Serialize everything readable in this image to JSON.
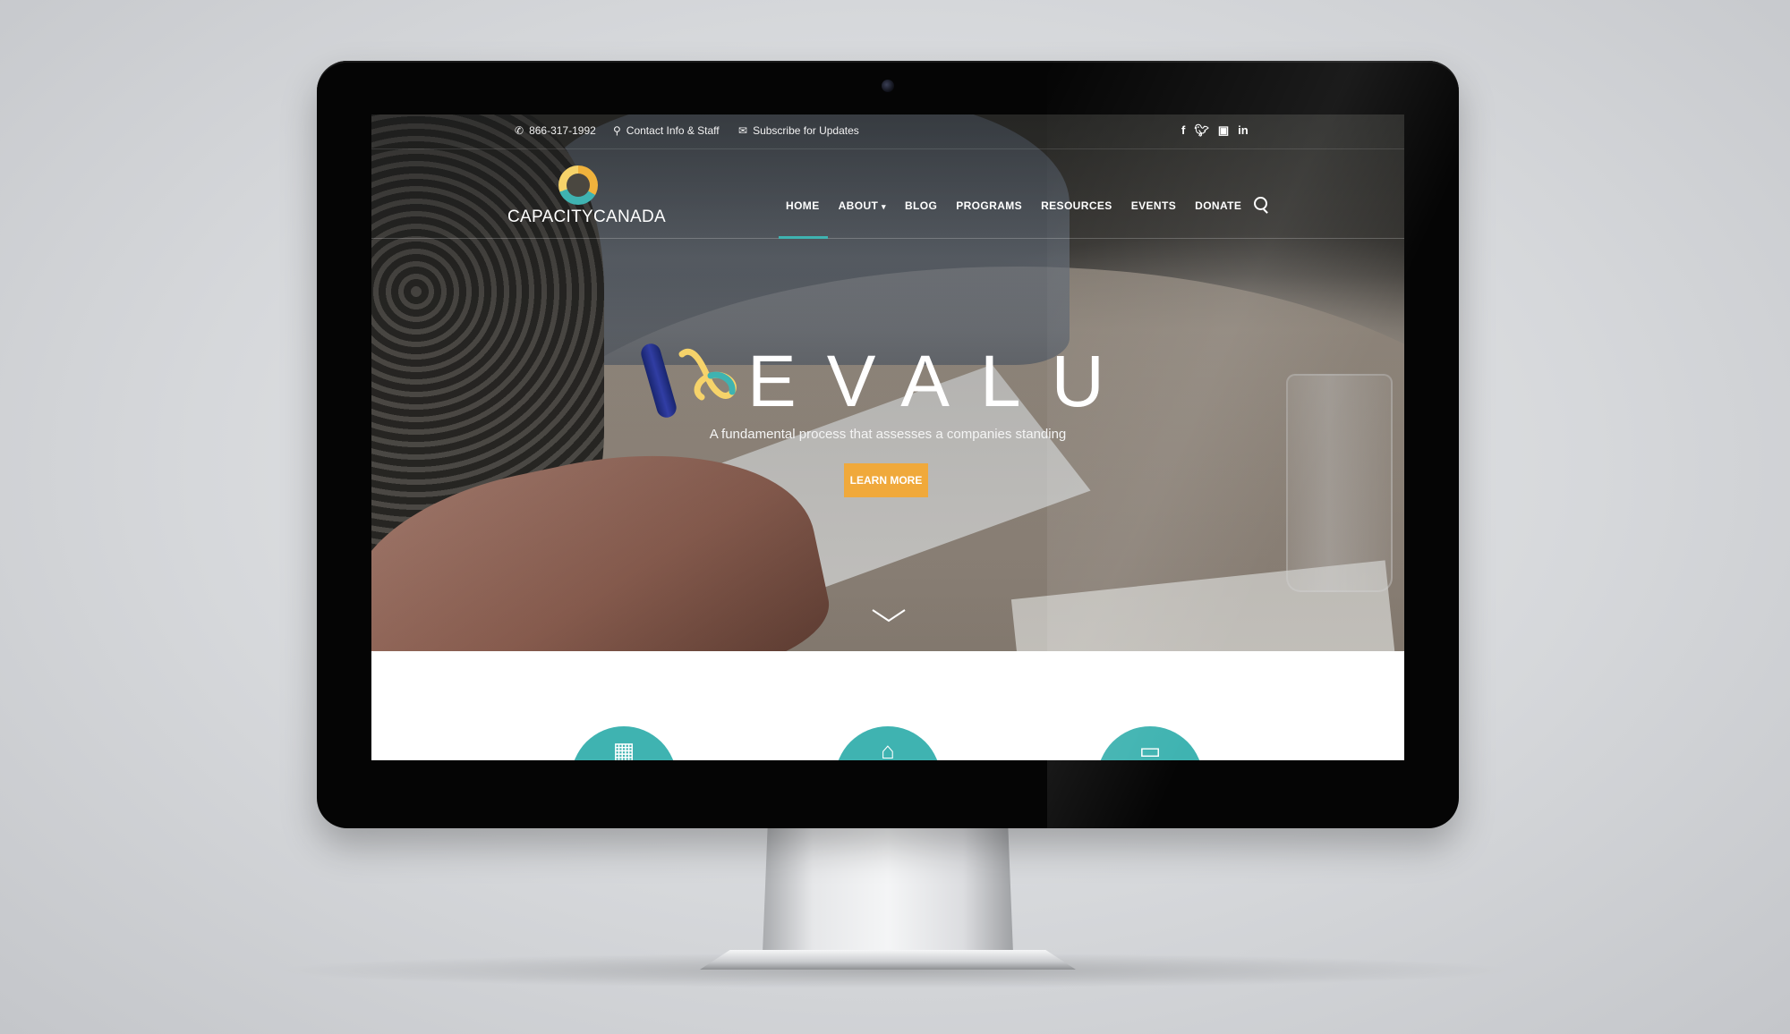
{
  "topbar": {
    "phone": "866-317-1992",
    "contact": "Contact Info & Staff",
    "subscribe": "Subscribe for Updates",
    "social": [
      "f",
      "t",
      "yt",
      "in"
    ]
  },
  "logo": {
    "capacity": "CAPACITY",
    "canada": "CANADA"
  },
  "nav": {
    "items": [
      "HOME",
      "ABOUT",
      "BLOG",
      "PROGRAMS",
      "RESOURCES",
      "EVENTS",
      "DONATE"
    ],
    "about_caret": "▾",
    "active": "HOME"
  },
  "hero": {
    "title": "EVALU",
    "tagline": "A fundamental process that assesses a companies standing",
    "button": "LEARN MORE"
  },
  "features": {
    "icons": [
      "calendar-icon",
      "home-icon",
      "presentation-icon"
    ]
  },
  "colors": {
    "accent_teal": "#3fb3b1",
    "button_orange": "#f0a93b",
    "logo_yellow": "#f6d36a"
  }
}
